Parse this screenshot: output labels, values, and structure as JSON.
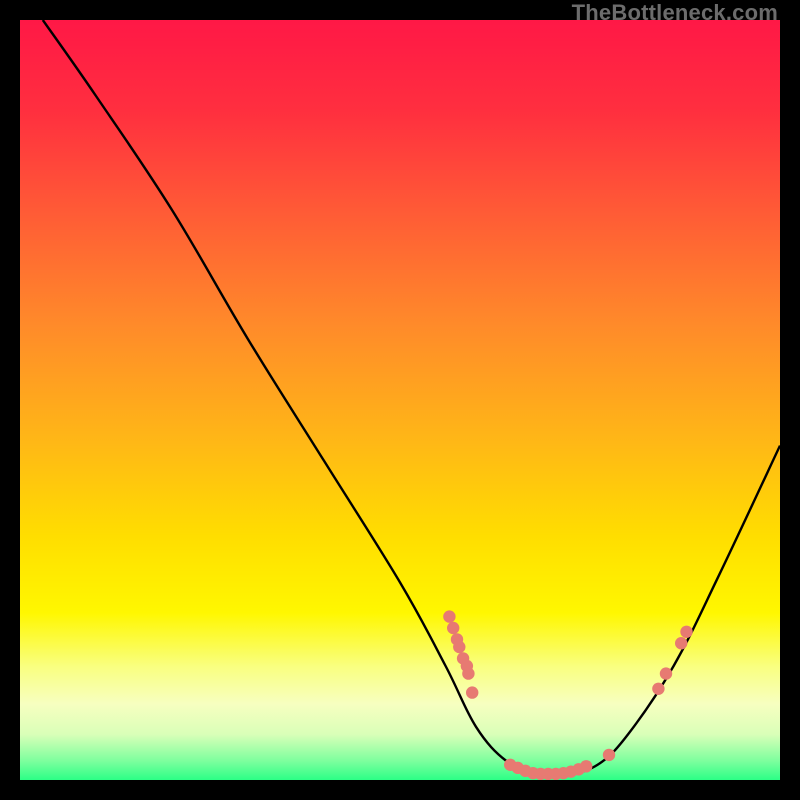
{
  "watermark": "TheBottleneck.com",
  "chart_data": {
    "type": "line",
    "title": "",
    "xlabel": "",
    "ylabel": "",
    "xlim": [
      0,
      100
    ],
    "ylim": [
      0,
      100
    ],
    "curve": [
      {
        "x": 3,
        "y": 100
      },
      {
        "x": 10,
        "y": 90
      },
      {
        "x": 20,
        "y": 75
      },
      {
        "x": 30,
        "y": 58
      },
      {
        "x": 40,
        "y": 42
      },
      {
        "x": 50,
        "y": 26
      },
      {
        "x": 56,
        "y": 15
      },
      {
        "x": 60,
        "y": 7
      },
      {
        "x": 64,
        "y": 2.5
      },
      {
        "x": 68,
        "y": 0.8
      },
      {
        "x": 72,
        "y": 0.8
      },
      {
        "x": 76,
        "y": 2
      },
      {
        "x": 80,
        "y": 6
      },
      {
        "x": 86,
        "y": 15
      },
      {
        "x": 92,
        "y": 27
      },
      {
        "x": 100,
        "y": 44
      }
    ],
    "markers": [
      {
        "x": 56.5,
        "y": 21.5
      },
      {
        "x": 57.0,
        "y": 20.0
      },
      {
        "x": 57.5,
        "y": 18.5
      },
      {
        "x": 57.8,
        "y": 17.5
      },
      {
        "x": 58.3,
        "y": 16.0
      },
      {
        "x": 58.8,
        "y": 15.0
      },
      {
        "x": 59.0,
        "y": 14.0
      },
      {
        "x": 59.5,
        "y": 11.5
      },
      {
        "x": 64.5,
        "y": 2.0
      },
      {
        "x": 65.5,
        "y": 1.6
      },
      {
        "x": 66.5,
        "y": 1.2
      },
      {
        "x": 67.5,
        "y": 0.9
      },
      {
        "x": 68.5,
        "y": 0.8
      },
      {
        "x": 69.5,
        "y": 0.8
      },
      {
        "x": 70.5,
        "y": 0.8
      },
      {
        "x": 71.5,
        "y": 0.9
      },
      {
        "x": 72.5,
        "y": 1.1
      },
      {
        "x": 73.5,
        "y": 1.4
      },
      {
        "x": 74.5,
        "y": 1.8
      },
      {
        "x": 77.5,
        "y": 3.3
      },
      {
        "x": 84.0,
        "y": 12.0
      },
      {
        "x": 85.0,
        "y": 14.0
      },
      {
        "x": 87.0,
        "y": 18.0
      },
      {
        "x": 87.7,
        "y": 19.5
      }
    ],
    "gradient_stops": [
      {
        "offset": 0.0,
        "color": "#ff1846"
      },
      {
        "offset": 0.12,
        "color": "#ff2f3f"
      },
      {
        "offset": 0.25,
        "color": "#ff5a36"
      },
      {
        "offset": 0.4,
        "color": "#ff8a2a"
      },
      {
        "offset": 0.55,
        "color": "#ffb617"
      },
      {
        "offset": 0.68,
        "color": "#ffde00"
      },
      {
        "offset": 0.78,
        "color": "#fff700"
      },
      {
        "offset": 0.85,
        "color": "#f9ff7f"
      },
      {
        "offset": 0.9,
        "color": "#f7ffc0"
      },
      {
        "offset": 0.94,
        "color": "#d9ffb8"
      },
      {
        "offset": 0.975,
        "color": "#7dff9e"
      },
      {
        "offset": 1.0,
        "color": "#2cff86"
      }
    ],
    "marker_color": "#e77a72",
    "curve_color": "#000000"
  }
}
